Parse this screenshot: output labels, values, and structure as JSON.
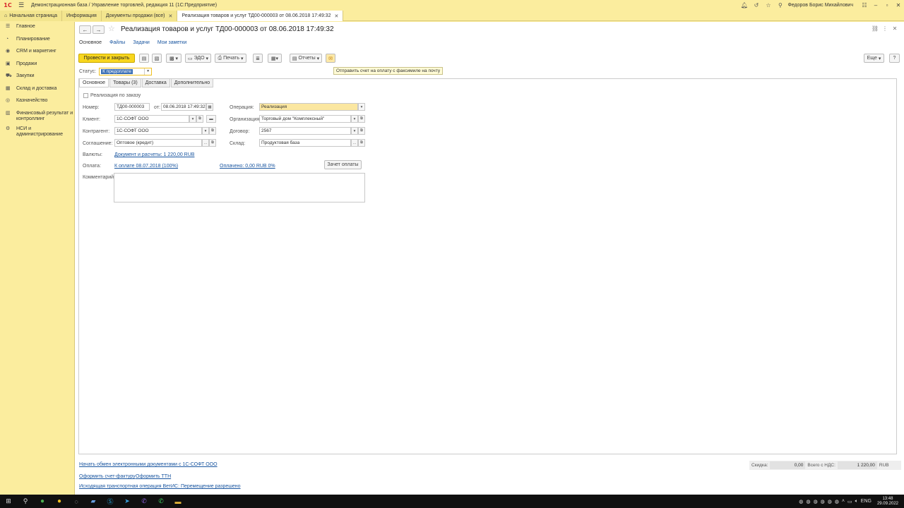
{
  "window": {
    "logo": "1С",
    "title": "Демонстрационная база / Управление торговлей, редакция 11  (1С:Предприятие)",
    "user": "Федоров Борис Михайлович"
  },
  "tabs": [
    {
      "label": "Начальная страница"
    },
    {
      "label": "Информация"
    },
    {
      "label": "Документы продажи (все)"
    },
    {
      "label": "Реализация товаров и услуг ТД00-000003 от 08.06.2018 17:49:32"
    }
  ],
  "sidebar": {
    "items": [
      {
        "label": "Главное"
      },
      {
        "label": "Планирование"
      },
      {
        "label": "CRM и маркетинг"
      },
      {
        "label": "Продажи"
      },
      {
        "label": "Закупки"
      },
      {
        "label": "Склад и доставка"
      },
      {
        "label": "Казначейство"
      },
      {
        "label": "Финансовый результат и контроллинг"
      },
      {
        "label": "НСИ и администрирование"
      }
    ]
  },
  "doc": {
    "title": "Реализация товаров и услуг ТД00-000003 от 08.06.2018 17:49:32",
    "subnav": [
      "Основное",
      "Файлы",
      "Задачи",
      "Мои заметки"
    ],
    "toolbar": {
      "post_close": "Провести и закрыть",
      "edo": "ЭДО",
      "print": "Печать",
      "reports": "Отчеты",
      "more": "Еще",
      "help": "?"
    },
    "tooltip": "Отправить счет на оплату с факсимиле на почту",
    "status_label": "Статус:",
    "status_value": "К предоплате",
    "form_tabs": [
      "Основное",
      "Товары (3)",
      "Доставка",
      "Дополнительно"
    ],
    "by_order_label": "Реализация по заказу",
    "number_label": "Номер:",
    "number_value": "ТД00-000003",
    "date_label": "от:",
    "date_value": "08.06.2018 17:49:32",
    "client_label": "Клиент:",
    "client_value": "1С-СОФТ ООО",
    "contractor_label": "Контрагент:",
    "contractor_value": "1С-СОФТ ООО",
    "agreement_label": "Соглашение:",
    "agreement_value": "Оптовое (кредит)",
    "currency_label": "Валюты:",
    "currency_link": "Документ и расчеты: 1 220,00 RUB",
    "payment_label": "Оплата:",
    "payment_link": "К оплате 08.07.2018 (100%)",
    "paid_link": "Оплачено: 0,00 RUB  0%",
    "offset_button": "Зачет оплаты",
    "comment_label": "Комментарий:",
    "operation_label": "Операция:",
    "operation_value": "Реализация",
    "org_label": "Организация:",
    "org_value": "Торговый дом \"Комплексный\"",
    "contract_label": "Договор:",
    "contract_value": "2567",
    "warehouse_label": "Склад:",
    "warehouse_value": "Продуктовая база"
  },
  "footer": {
    "edo_link": "Начать обмен электронными документами с 1С-СОФТ ООО",
    "invoice_link": "Оформить счет-фактуру",
    "ttn_link": "Оформить ТТН",
    "vetis_link": "Исходящая транспортная операция ВетИС: Перемещение разрешено",
    "discount_label": "Скидка:",
    "discount_value": "0,00",
    "total_label": "Всего с НДС:",
    "total_value": "1 220,00",
    "currency": "RUB"
  },
  "taskbar": {
    "lang": "ENG",
    "time": "13:48",
    "date": "29.09.2022"
  },
  "colors": {
    "chrome": "#fbed9e",
    "primary_button": "#f8d61e",
    "link": "#1a56a0"
  }
}
